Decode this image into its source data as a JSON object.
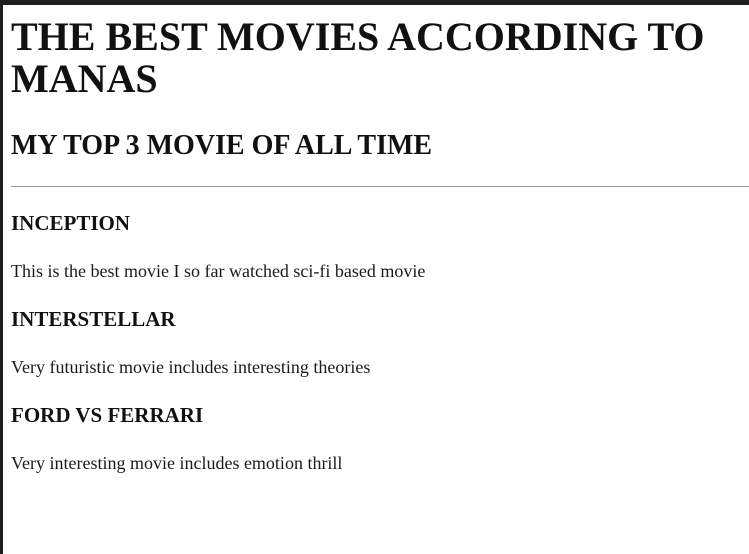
{
  "page": {
    "title": "THE BEST MOVIES ACCORDING TO MANAS",
    "subtitle": "MY TOP 3 MOVIE OF ALL TIME"
  },
  "movies": [
    {
      "name": "INCEPTION",
      "description": "This is the best movie I so far watched sci-fi based movie"
    },
    {
      "name": "INTERSTELLAR",
      "description": "Very futuristic movie includes interesting theories"
    },
    {
      "name": "FORD VS FERRARI",
      "description": "Very interesting movie includes emotion thrill"
    }
  ]
}
